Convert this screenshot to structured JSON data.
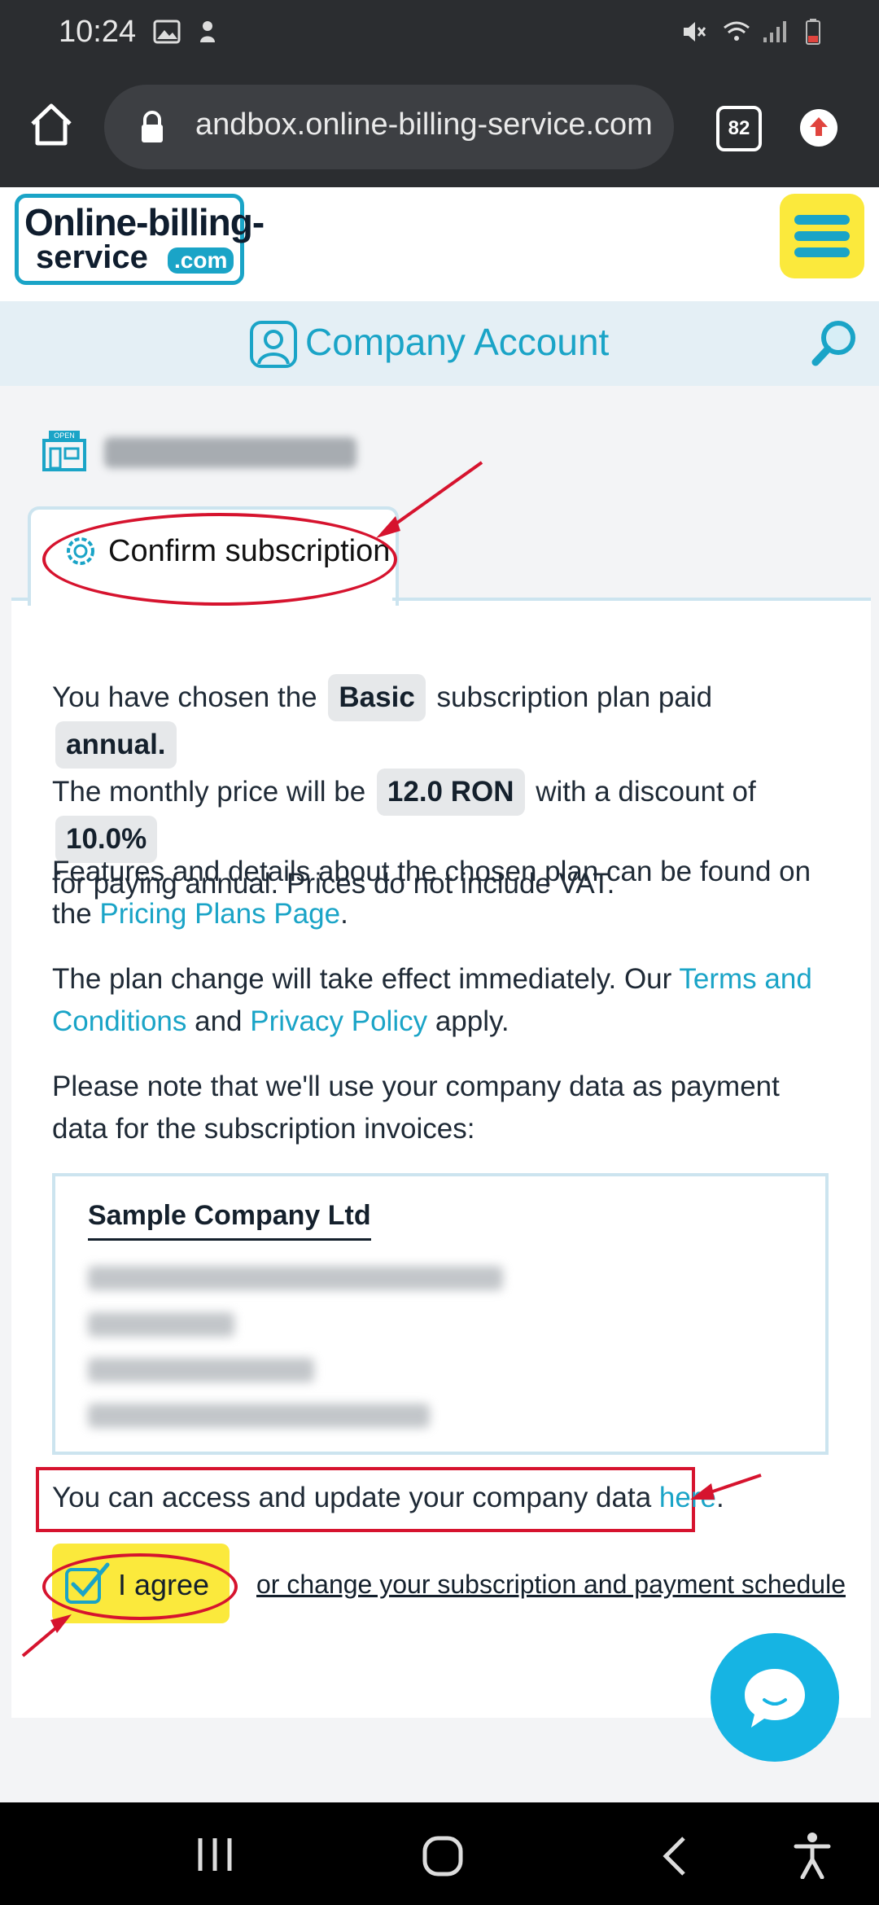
{
  "status_bar": {
    "time": "10:24"
  },
  "browser": {
    "url": "andbox.online-billing-service.com",
    "tab_count": "82"
  },
  "site": {
    "logo_line1": "Online-billing-",
    "logo_line2": "service",
    "logo_com": ".com",
    "section_title": "Company Account"
  },
  "tab": {
    "label": "Confirm subscription"
  },
  "summary": {
    "p1_a": "You have chosen the",
    "plan": "Basic",
    "p1_b": "subscription plan paid",
    "billing": "annual.",
    "p1_c": "The monthly price will be",
    "price": "12.0 RON",
    "p1_d": "with a discount of",
    "discount": "10.0%",
    "p1_e": "for paying annual. Prices do not include VAT."
  },
  "features": {
    "text": "Features and details about the chosen plan can be found on the",
    "link": "Pricing Plans Page",
    "end": "."
  },
  "terms": {
    "a": "The plan change will take effect immediately. Our",
    "terms_link": "Terms and Conditions",
    "b": "and",
    "privacy_link": "Privacy Policy",
    "c": "apply."
  },
  "note": "Please note that we'll use your company data as payment data for the subscription invoices:",
  "company_card": {
    "name": "Sample Company Ltd"
  },
  "access": {
    "text": "You can access and update your company data",
    "link": "here",
    "end": "."
  },
  "actions": {
    "agree": "I agree",
    "change": "or change your subscription and payment schedule"
  },
  "colors": {
    "accent": "#1aa4c7",
    "highlight": "#fbe93c",
    "annotation": "#d6132e"
  }
}
